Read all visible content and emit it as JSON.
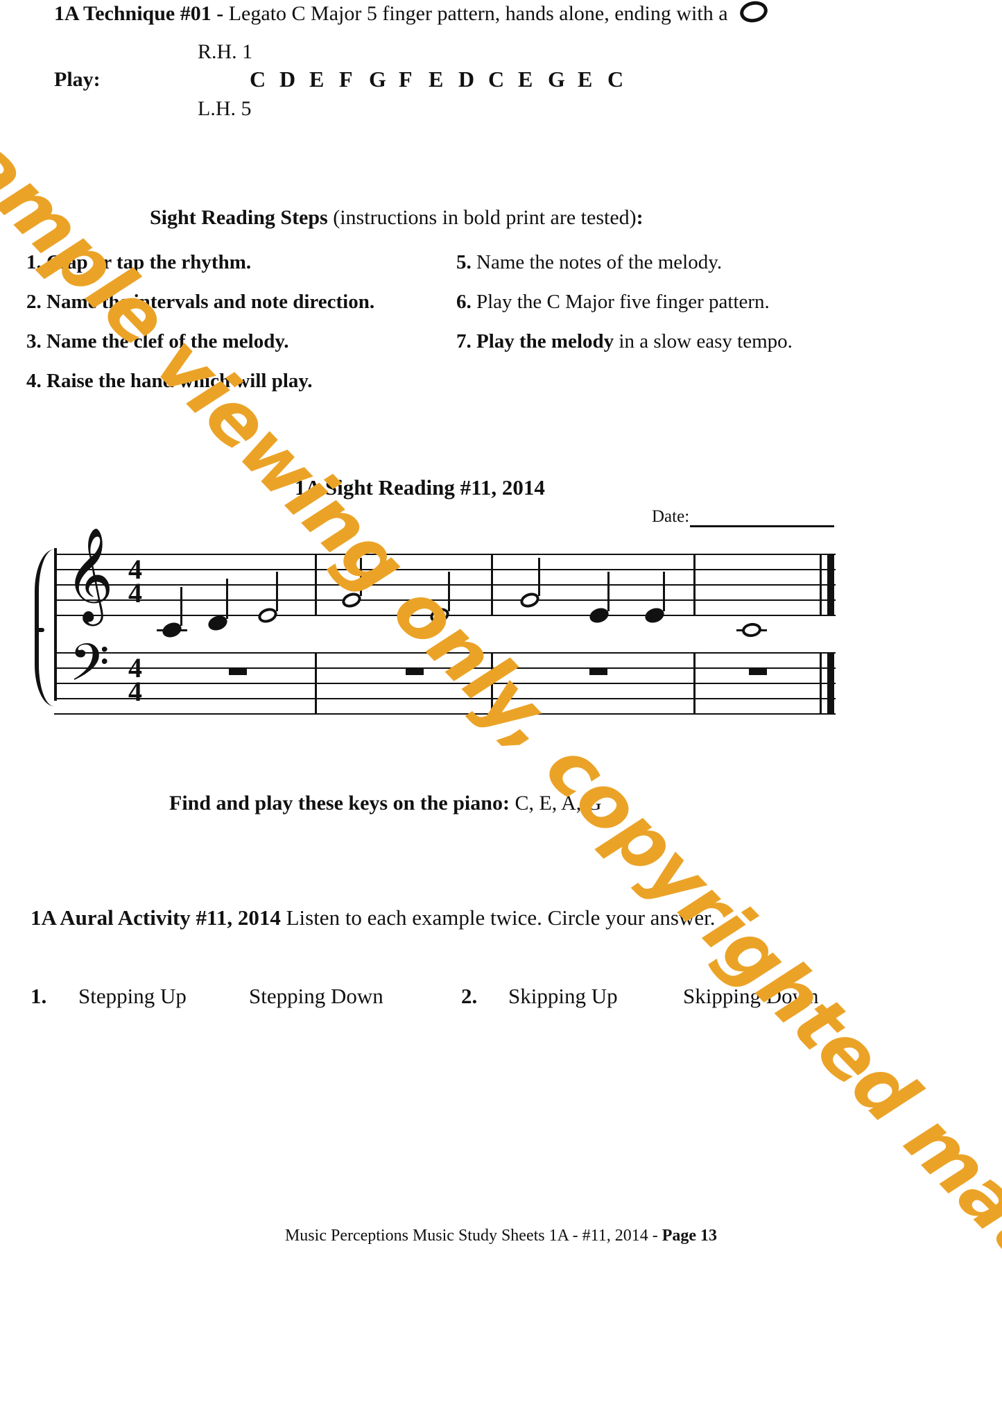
{
  "technique": {
    "label": "1A Technique #01 - ",
    "text": "Legato C Major 5 finger pattern, hands alone, ending with a ",
    "ending_symbol": "whole-note"
  },
  "play_block": {
    "play_label": "Play:",
    "rh_label": "R.H. 1",
    "lh_label": "L.H. 5",
    "note_letters": [
      "C",
      "D",
      "E",
      "F",
      "G",
      "F",
      "E",
      "D",
      "C",
      "E",
      "G",
      "E",
      "C"
    ]
  },
  "sight_reading_steps": {
    "heading_bold": "Sight Reading Steps",
    "heading_rest": " (instructions in bold print are tested)",
    "heading_colon": ":",
    "left_column": [
      {
        "num": "1.",
        "bold": "Clap or tap the rhythm.",
        "normal": ""
      },
      {
        "num": "2.",
        "bold": "Name the intervals and note direction.",
        "normal": ""
      },
      {
        "num": "3.",
        "bold": "Name the clef of the melody.",
        "normal": ""
      },
      {
        "num": "4.",
        "bold": "Raise the hand which will play.",
        "normal": ""
      }
    ],
    "right_column": [
      {
        "num": "5.",
        "bold": "",
        "normal": "Name the notes of the melody."
      },
      {
        "num": "6.",
        "bold": "",
        "normal": "Play the C Major five finger pattern."
      },
      {
        "num": "7.",
        "bold": "Play the melody",
        "normal": " in a slow easy tempo."
      }
    ]
  },
  "sight_reading": {
    "title": "1A Sight Reading #11, 2014",
    "date_label": "Date:",
    "date_value": ""
  },
  "score": {
    "time_signature": {
      "top": "4",
      "bottom": "4"
    },
    "treble_clef": "ᴑE",
    "bass_clef": "ᴒ2",
    "measures": [
      {
        "index": 1,
        "treble": [
          {
            "pitch": "C4",
            "duration": "quarter",
            "ledger": true
          },
          {
            "pitch": "D4",
            "duration": "quarter",
            "ledger": false
          },
          {
            "pitch": "E4",
            "duration": "half",
            "ledger": false
          }
        ],
        "bass": [
          {
            "rest": "whole"
          }
        ]
      },
      {
        "index": 2,
        "treble": [
          {
            "pitch": "G4",
            "duration": "half",
            "ledger": false
          },
          {
            "pitch": "E4",
            "duration": "half",
            "ledger": false
          }
        ],
        "bass": [
          {
            "rest": "whole"
          }
        ]
      },
      {
        "index": 3,
        "treble": [
          {
            "pitch": "G4",
            "duration": "half",
            "ledger": false
          },
          {
            "pitch": "E4",
            "duration": "quarter",
            "ledger": false
          },
          {
            "pitch": "E4",
            "duration": "quarter",
            "ledger": false
          }
        ],
        "bass": [
          {
            "rest": "whole"
          }
        ]
      },
      {
        "index": 4,
        "treble": [
          {
            "pitch": "C4",
            "duration": "whole",
            "ledger": true
          }
        ],
        "bass": [
          {
            "rest": "whole"
          }
        ]
      }
    ]
  },
  "find_play": {
    "bold": "Find and play these keys on the piano:",
    "keys": " C,  E,  A,  G"
  },
  "aural": {
    "title": "1A Aural Activity #11, 2014",
    "instruction": "  Listen to each example twice. Circle your answer.",
    "items": [
      {
        "num": "1.",
        "option_a": "Stepping Up",
        "option_b": "Stepping Down"
      },
      {
        "num": "2.",
        "option_a": "Skipping Up",
        "option_b": "Skipping Down"
      }
    ]
  },
  "footer": {
    "text_normal": "Music Perceptions Music Study Sheets 1A - #11, 2014 - ",
    "text_bold": "Page 13"
  },
  "watermark": {
    "text": "Sample viewing only, copyrighted material.",
    "color": "#eba327"
  }
}
